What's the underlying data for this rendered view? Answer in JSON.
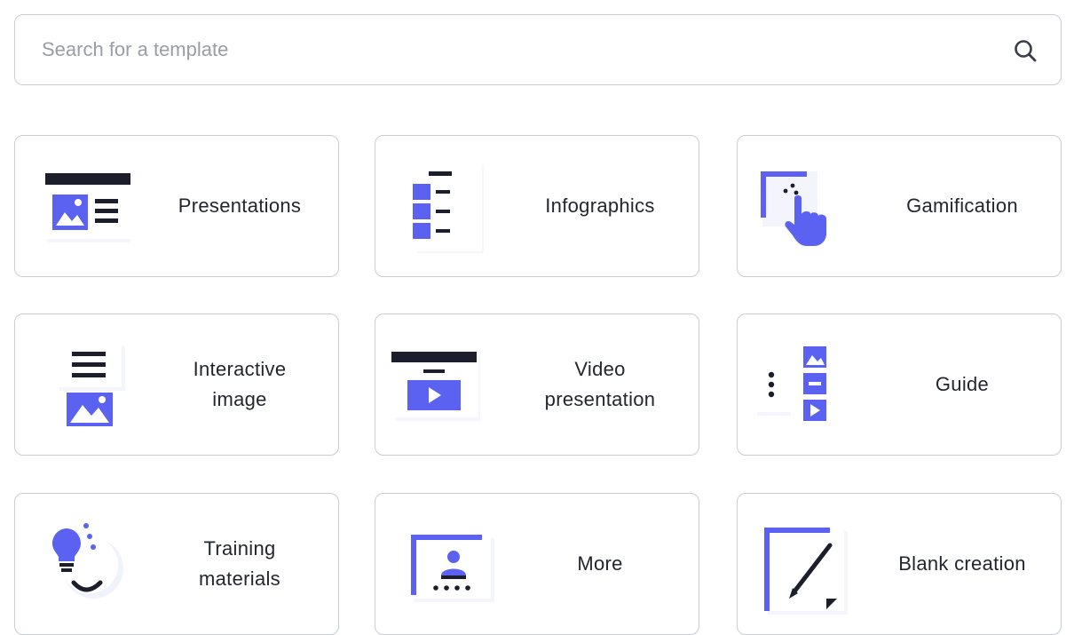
{
  "search": {
    "placeholder": "Search for a template",
    "icon": "search-icon"
  },
  "colors": {
    "accent": "#5b62f2",
    "ink": "#1c1f2b",
    "border": "#c9ccd3",
    "placeholder": "#9a9da6"
  },
  "cards": [
    {
      "label": "Presentations",
      "icon": "presentation-icon"
    },
    {
      "label": "Infographics",
      "icon": "infographic-icon"
    },
    {
      "label": "Gamification",
      "icon": "gamification-icon"
    },
    {
      "label": "Interactive\nimage",
      "icon": "interactive-image-icon"
    },
    {
      "label": "Video\npresentation",
      "icon": "video-presentation-icon"
    },
    {
      "label": "Guide",
      "icon": "guide-icon"
    },
    {
      "label": "Training\nmaterials",
      "icon": "training-icon"
    },
    {
      "label": "More",
      "icon": "more-icon"
    },
    {
      "label": "Blank creation",
      "icon": "blank-creation-icon"
    }
  ]
}
